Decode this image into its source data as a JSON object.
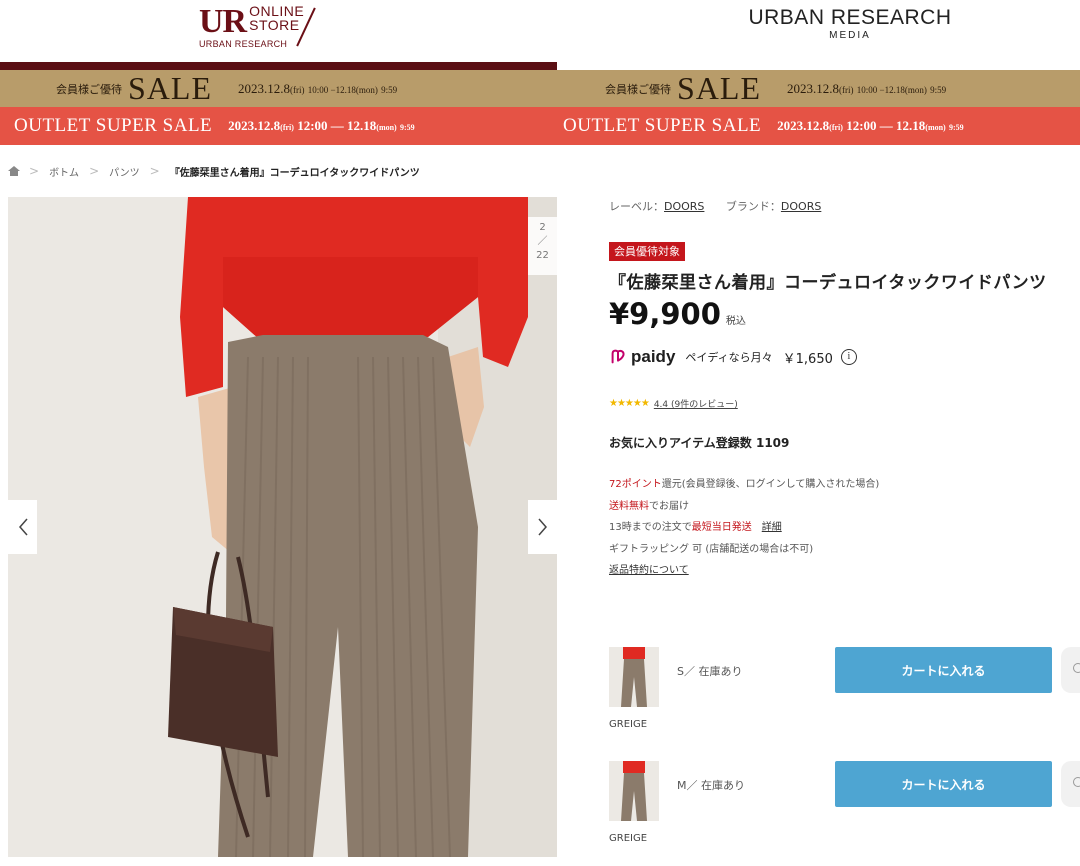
{
  "header": {
    "logo_ur": "UR",
    "logo_online": "ONLINE",
    "logo_store": "STORE",
    "logo_sub": "URBAN RESEARCH",
    "media_title": "URBAN RESEARCH",
    "media_sub": "MEDIA"
  },
  "sale_banner": {
    "member_text": "会員様ご優待",
    "sale_word": "SALE",
    "dates_main": "2023.12.8",
    "dates_start_day": "(fri)",
    "dates_start_time": "10:00 −12.18",
    "dates_end_day": "(mon)",
    "dates_end_time": "9:59"
  },
  "outlet_banner": {
    "title": "OUTLET SUPER SALE",
    "dates_main": "2023.12.8",
    "start_day": "(fri)",
    "start_time": "12:00 — 12.18",
    "end_day": "(mon)",
    "end_time": "9:59"
  },
  "breadcrumb": {
    "items": [
      "ボトム",
      "パンツ"
    ],
    "current": "『佐藤栞里さん着用』コーデュロイタックワイドパンツ"
  },
  "gallery": {
    "current": "2",
    "slash": "／",
    "total": "22"
  },
  "product": {
    "label_prefix": "レーベル：",
    "label_value": "DOORS",
    "brand_prefix": "ブランド：",
    "brand_value": "DOORS",
    "badge": "会員優待対象",
    "title": "『佐藤栞里さん着用』コーデュロイタックワイドパンツ",
    "price": "¥9,900",
    "tax": "税込",
    "paidy_brand": "paidy",
    "paidy_text": "ペイディなら月々",
    "paidy_amount": "￥1,650",
    "rating_stars": "★★★★★",
    "rating_value": 4.4,
    "rating_text": "4.4 (9件のレビュー)",
    "favorite_text": "お気に入りアイテム登録数 1109",
    "points_red": "72ポイント",
    "points_rest": "還元(会員登録後、ログインして購入された場合)",
    "shipping_red": "送料無料",
    "shipping_rest": "でお届け",
    "sameday_prefix": "13時までの注文で",
    "sameday_red": "最短当日発送",
    "sameday_link": "詳細",
    "gift": "ギフトラッピング 可 (店舗配送の場合は不可)",
    "returns_link": "返品特約について"
  },
  "variants": [
    {
      "size": "S／ 在庫あり",
      "color": "GREIGE",
      "cart_label": "カートに入れる"
    },
    {
      "size": "M／ 在庫あり",
      "color": "GREIGE",
      "cart_label": "カートに入れる"
    }
  ],
  "colors": {
    "brand_dark": "#6b0f16",
    "sale_gold": "#b89c6a",
    "outlet_red": "#e55345",
    "cart_blue": "#4ea5d2",
    "badge_red": "#c4161c"
  }
}
